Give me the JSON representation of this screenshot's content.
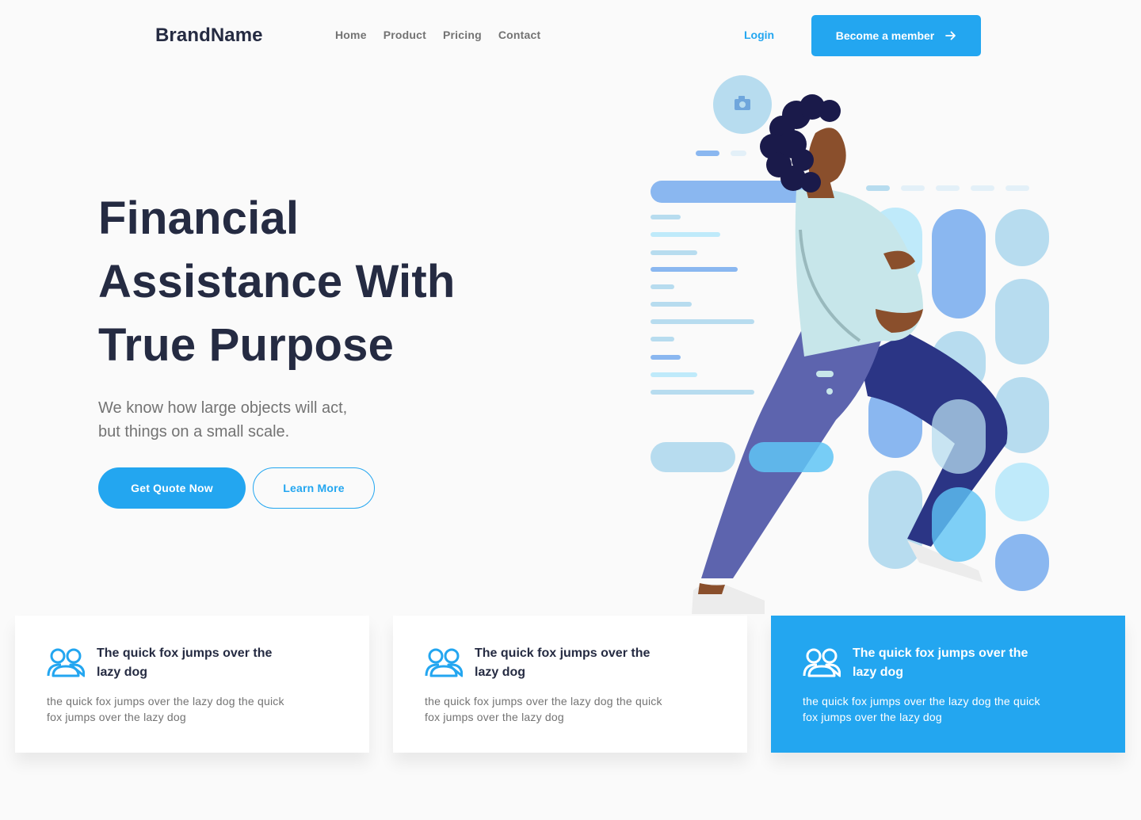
{
  "header": {
    "brand": "BrandName",
    "nav": [
      "Home",
      "Product",
      "Pricing",
      "Contact"
    ],
    "login_label": "Login",
    "member_button_label": "Become a member",
    "member_button_icon": "arrow-right-icon"
  },
  "hero": {
    "title_lines": [
      "Financial",
      "Assistance With",
      "True Purpose"
    ],
    "subtitle_lines": [
      "We know how large objects will act,",
      "but things on a small scale."
    ],
    "primary_button": "Get Quote Now",
    "secondary_button": "Learn More",
    "illustration_icon": "camera-icon"
  },
  "features": [
    {
      "icon": "users-icon",
      "title_lines": [
        "The quick fox jumps over the",
        "lazy dog"
      ],
      "text_lines": [
        "the quick fox jumps over the lazy dog the quick",
        "fox jumps over the lazy dog"
      ]
    },
    {
      "icon": "users-icon",
      "title_lines": [
        "The quick fox jumps over the",
        "lazy dog"
      ],
      "text_lines": [
        "the quick fox jumps over the lazy dog the quick",
        "fox jumps over the lazy dog"
      ]
    },
    {
      "icon": "users-icon",
      "title_lines": [
        "The quick fox jumps over the",
        "lazy dog"
      ],
      "text_lines": [
        "the quick fox jumps over the lazy dog the quick",
        "fox jumps over the lazy dog"
      ]
    }
  ],
  "colors": {
    "primary": "#23a6f0",
    "heading": "#252b42",
    "body_text": "#737373",
    "background": "#fafafa"
  }
}
